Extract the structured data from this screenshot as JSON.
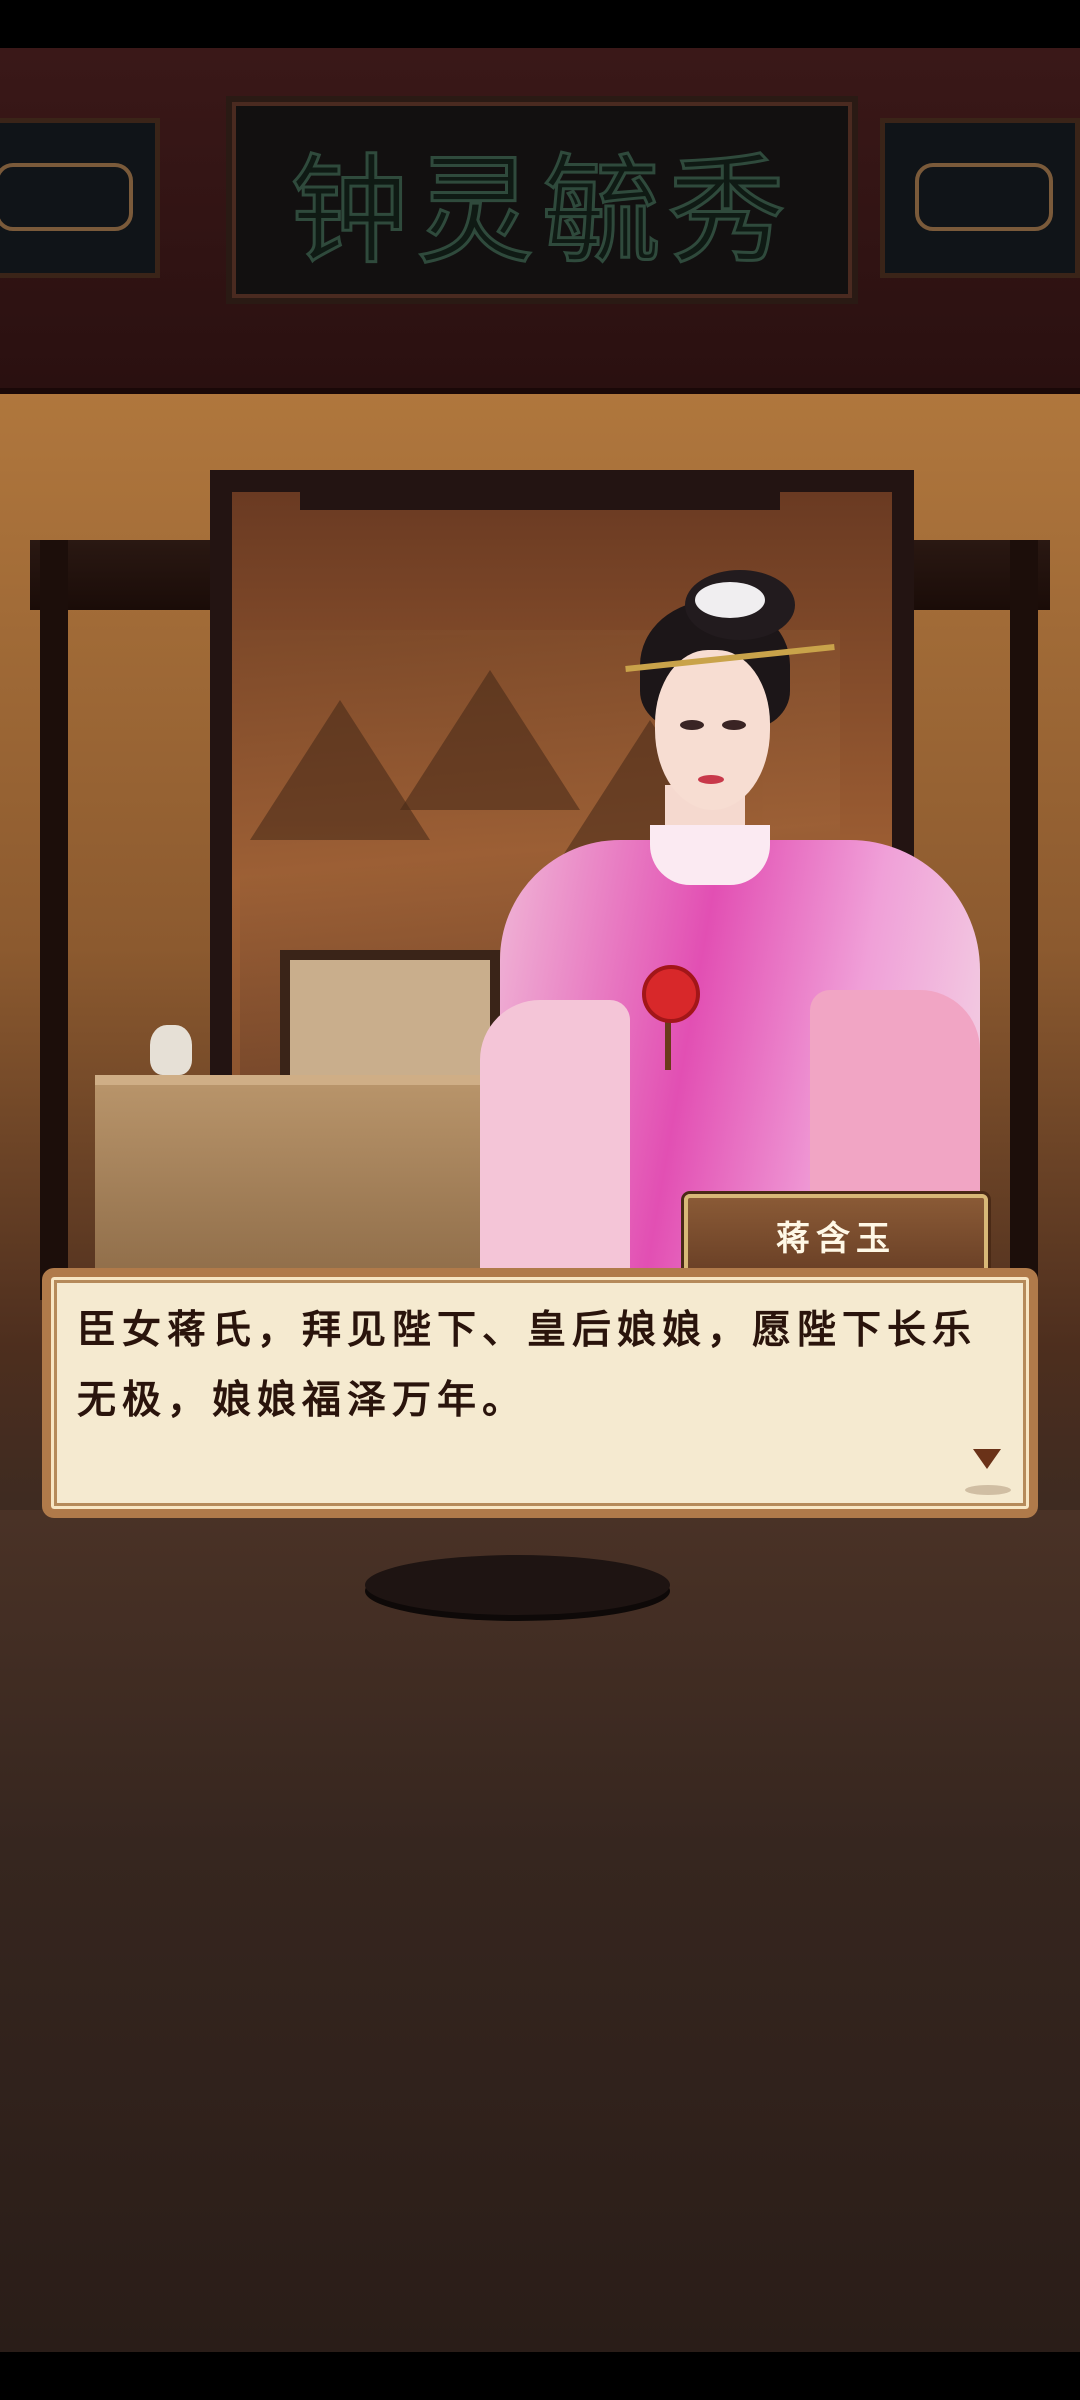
{
  "scene": {
    "plaque_text": "钟灵毓秀"
  },
  "dialog": {
    "speaker": "蒋含玉",
    "text": "臣女蒋氏，拜见陛下、皇后娘娘，愿陛下长乐无极，娘娘福泽万年。",
    "next_icon": "triangle-down-icon"
  },
  "colors": {
    "dialog_bg": "#f5ead0",
    "dialog_border": "#b07a4a",
    "nameplate_bg": "#7a4a2c",
    "text": "#2a140c"
  }
}
